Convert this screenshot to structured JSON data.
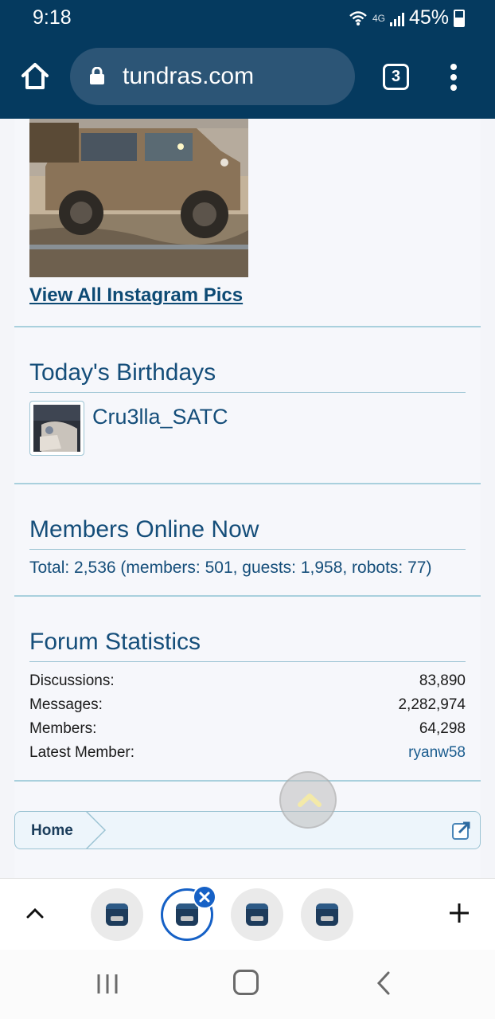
{
  "status_bar": {
    "time": "9:18",
    "network": "4G",
    "battery": "45%"
  },
  "browser": {
    "url": "tundras.com",
    "tab_count": "3"
  },
  "instagram": {
    "link_text": "View All Instagram Pics"
  },
  "birthdays": {
    "title": "Today's Birthdays",
    "members": [
      {
        "name": "Cru3lla_SATC"
      }
    ]
  },
  "members_online": {
    "title": "Members Online Now",
    "total_text": "Total: 2,536 (members: 501, guests: 1,958, robots: 77)"
  },
  "forum_statistics": {
    "title": "Forum Statistics",
    "rows": [
      {
        "label": "Discussions:",
        "value": "83,890"
      },
      {
        "label": "Messages:",
        "value": "2,282,974"
      },
      {
        "label": "Members:",
        "value": "64,298"
      },
      {
        "label": "Latest Member:",
        "value": "ryanw58"
      }
    ]
  },
  "breadcrumb": {
    "home_label": "Home"
  },
  "icons": {
    "home": "home-icon",
    "lock": "lock-icon",
    "menu": "more-vert-icon",
    "scroll_top": "chevron-up-icon",
    "add_tab": "plus-icon",
    "close_tab": "close-icon",
    "external": "external-link-icon"
  },
  "colors": {
    "toolbar": "#053a5f",
    "heading": "#154e7a",
    "link": "#0d4a74",
    "accent_tab": "#1661c6"
  }
}
